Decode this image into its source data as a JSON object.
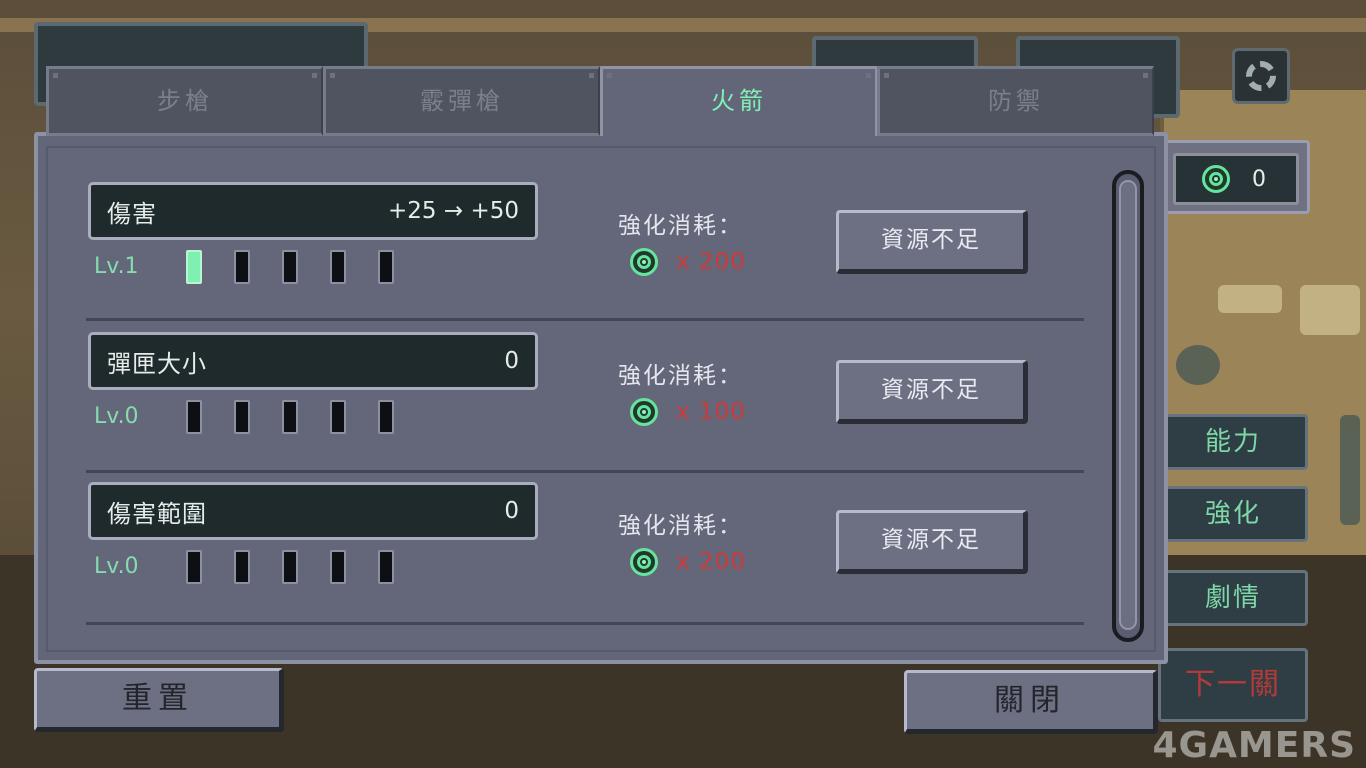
{
  "tabs": [
    {
      "label": "步槍",
      "active": false
    },
    {
      "label": "霰彈槍",
      "active": false
    },
    {
      "label": "火箭",
      "active": true
    },
    {
      "label": "防禦",
      "active": false
    }
  ],
  "upgrades": [
    {
      "name": "傷害",
      "value": "+25 → +50",
      "level": "Lv.1",
      "filled": 1,
      "total": 5,
      "cost_label": "強化消耗：",
      "cost": "x  200",
      "button": "資源不足"
    },
    {
      "name": "彈匣大小",
      "value": "0",
      "level": "Lv.0",
      "filled": 0,
      "total": 5,
      "cost_label": "強化消耗：",
      "cost": "x  100",
      "button": "資源不足"
    },
    {
      "name": "傷害範圍",
      "value": "0",
      "level": "Lv.0",
      "filled": 0,
      "total": 5,
      "cost_label": "強化消耗：",
      "cost": "x  200",
      "button": "資源不足"
    }
  ],
  "resource": {
    "icon": "gem-icon",
    "count": "0"
  },
  "side_menu": [
    {
      "label": "能力"
    },
    {
      "label": "強化"
    },
    {
      "label": "劇情"
    },
    {
      "label": "下一關"
    }
  ],
  "buttons": {
    "reset": "重置",
    "close": "關閉"
  },
  "watermark": "4GAMERS",
  "colors": {
    "accent": "#7ff0b2",
    "insufficient": "#cc3a3a",
    "panel": "#636679"
  }
}
